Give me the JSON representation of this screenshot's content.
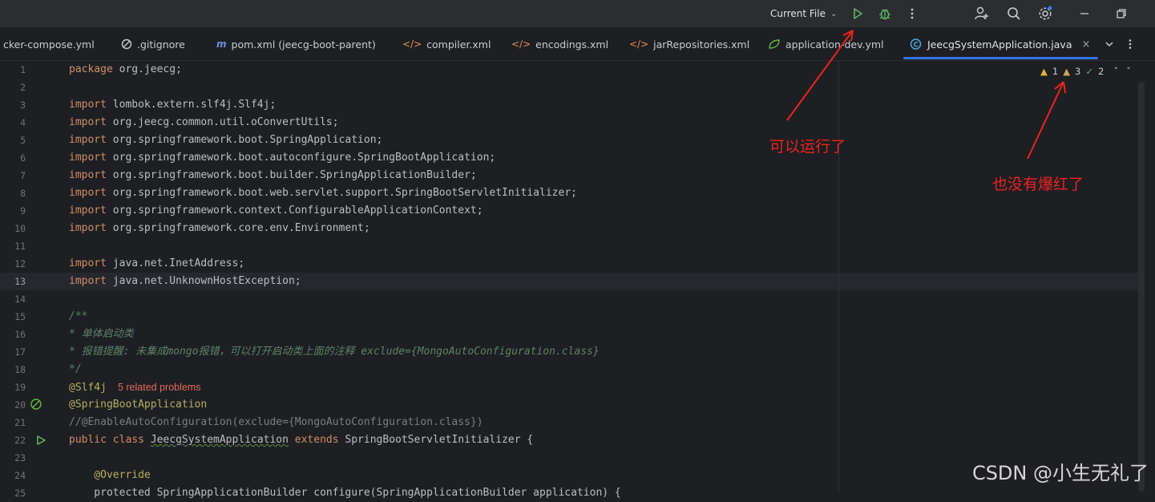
{
  "toolbar": {
    "run_config": "Current File",
    "icons": [
      "run-icon",
      "debug-icon",
      "more-icon",
      "add-user-icon",
      "search-icon",
      "settings-icon",
      "minimize-icon",
      "restore-icon"
    ]
  },
  "tabs": [
    {
      "label": "cker-compose.yml",
      "icon": "yaml-icon"
    },
    {
      "label": ".gitignore",
      "icon": "ignore-icon"
    },
    {
      "label": "pom.xml (jeecg-boot-parent)",
      "icon": "maven-icon"
    },
    {
      "label": "compiler.xml",
      "icon": "xml-icon"
    },
    {
      "label": "encodings.xml",
      "icon": "xml-icon"
    },
    {
      "label": "jarRepositories.xml",
      "icon": "xml-icon"
    },
    {
      "label": "application-dev.yml",
      "icon": "spring-icon"
    },
    {
      "label": "JeecgSystemApplication.java",
      "icon": "java-class-icon",
      "active": true
    }
  ],
  "inspections": {
    "warnings": "1",
    "weak_warnings": "3",
    "ok": "2"
  },
  "lines": [
    {
      "n": "1"
    },
    {
      "n": "2"
    },
    {
      "n": "3"
    },
    {
      "n": "4"
    },
    {
      "n": "5"
    },
    {
      "n": "6"
    },
    {
      "n": "7"
    },
    {
      "n": "8"
    },
    {
      "n": "9"
    },
    {
      "n": "10"
    },
    {
      "n": "11"
    },
    {
      "n": "12"
    },
    {
      "n": "13"
    },
    {
      "n": "14"
    },
    {
      "n": "15"
    },
    {
      "n": "16"
    },
    {
      "n": "17"
    },
    {
      "n": "18"
    },
    {
      "n": "19"
    },
    {
      "n": "20"
    },
    {
      "n": "21"
    },
    {
      "n": "22"
    },
    {
      "n": "23"
    },
    {
      "n": "24"
    },
    {
      "n": "25"
    }
  ],
  "code": {
    "l1_kw": "package",
    "l1_rest": " org.jeecg;",
    "imports": [
      "lombok.extern.slf4j.Slf4j;",
      "org.jeecg.common.util.oConvertUtils;",
      "org.springframework.boot.SpringApplication;",
      "org.springframework.boot.autoconfigure.SpringBootApplication;",
      "org.springframework.boot.builder.SpringApplicationBuilder;",
      "org.springframework.boot.web.servlet.support.SpringBootServletInitializer;",
      "org.springframework.context.ConfigurableApplicationContext;",
      "org.springframework.core.env.Environment;",
      "java.net.InetAddress;",
      "java.net.UnknownHostException;"
    ],
    "import_kw": "import",
    "doc_open": "/**",
    "doc_line1": "* 单体启动类",
    "doc_line2": "* 报错提醒: 未集成mongo报错，可以打开启动类上面的注释 exclude={MongoAutoConfiguration.class}",
    "doc_close": "*/",
    "slf4j": "@Slf4j",
    "related_problems": "5 related problems",
    "spring_boot_app": "@SpringBootApplication",
    "commented": "//@EnableAutoConfiguration(exclude={MongoAutoConfiguration.class})",
    "public": "public",
    "class": "class",
    "class_name": "JeecgSystemApplication",
    "extends": "extends",
    "super_class": " SpringBootServletInitializer {",
    "override": "@Override",
    "l25": "    protected SpringApplicationBuilder configure(SpringApplicationBuilder application) {"
  },
  "annotations": {
    "note1": "可以运行了",
    "note2": "也没有爆红了",
    "arrow_color": "#ee2222"
  },
  "watermark": "CSDN @小生无礼了"
}
